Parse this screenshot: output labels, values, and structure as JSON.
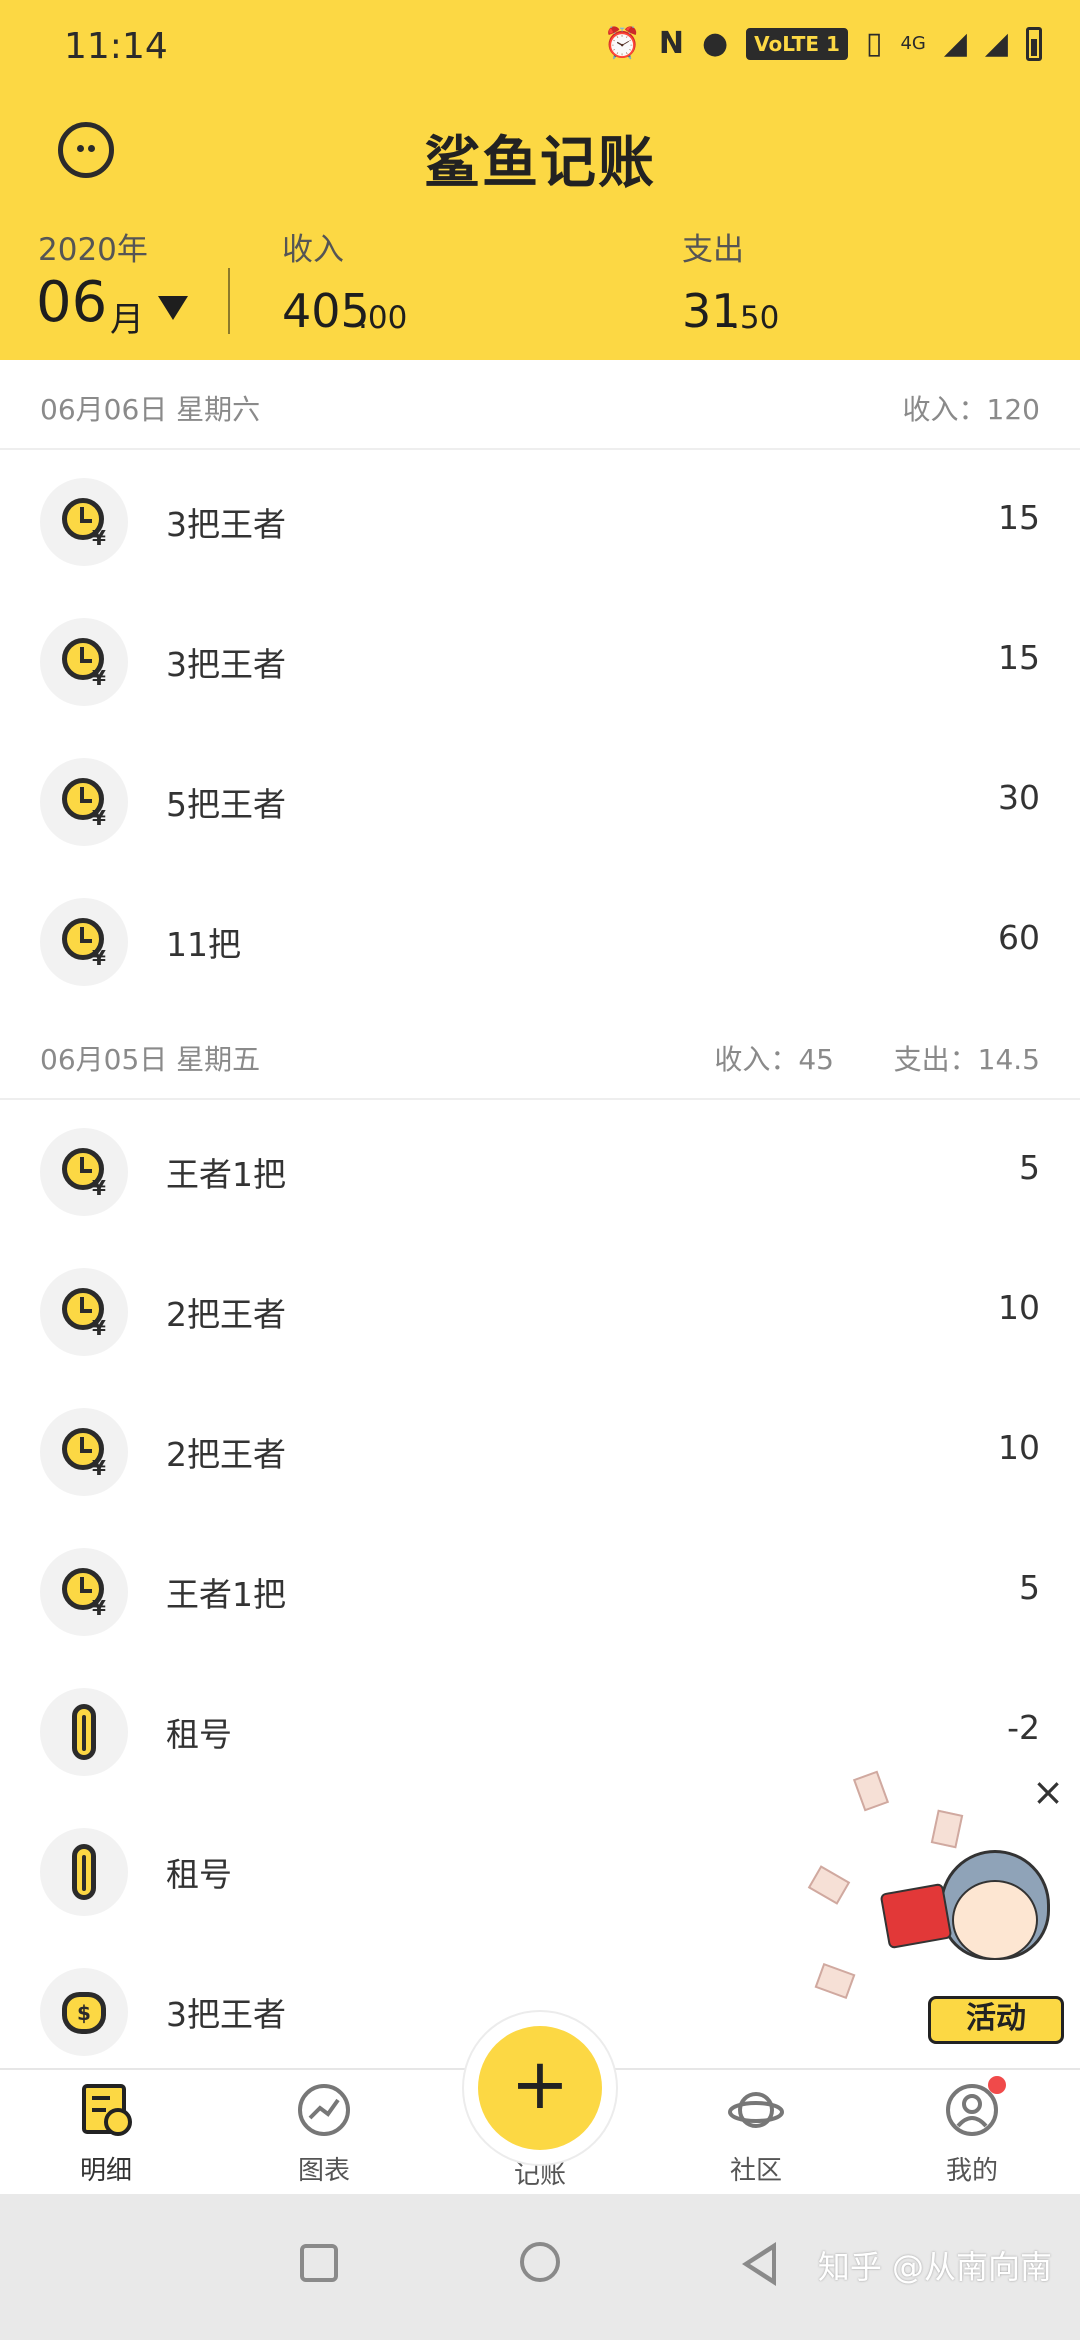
{
  "status_bar": {
    "time": "11:14",
    "network": "VoLTE 1",
    "signal": "4G"
  },
  "header": {
    "app_title": "鲨鱼记账",
    "year": "2020年",
    "month": "06",
    "month_suffix": "月",
    "income_label": "收入",
    "income_int": "405",
    "income_dec": ".00",
    "expense_label": "支出",
    "expense_int": "31",
    "expense_dec": ".50"
  },
  "days": [
    {
      "date": "06月06日 星期六",
      "income_summary": "收入：120",
      "items": [
        {
          "icon": "clock-yen-icon",
          "label": "3把王者",
          "amount": "15"
        },
        {
          "icon": "clock-yen-icon",
          "label": "3把王者",
          "amount": "15"
        },
        {
          "icon": "clock-yen-icon",
          "label": "5把王者",
          "amount": "30"
        },
        {
          "icon": "clock-yen-icon",
          "label": "11把",
          "amount": "60"
        }
      ]
    },
    {
      "date": "06月05日 星期五",
      "income_summary": "收入：45",
      "expense_summary": "支出：14.5",
      "items": [
        {
          "icon": "clock-yen-icon",
          "label": "王者1把",
          "amount": "5"
        },
        {
          "icon": "clock-yen-icon",
          "label": "2把王者",
          "amount": "10"
        },
        {
          "icon": "clock-yen-icon",
          "label": "2把王者",
          "amount": "10"
        },
        {
          "icon": "clock-yen-icon",
          "label": "王者1把",
          "amount": "5"
        },
        {
          "icon": "paperclip-icon",
          "label": "租号",
          "amount": "-2"
        },
        {
          "icon": "paperclip-icon",
          "label": "租号",
          "amount": "-"
        },
        {
          "icon": "money-bag-icon",
          "label": "3把王者",
          "amount": ""
        }
      ]
    }
  ],
  "activity": {
    "label": "活动",
    "close": "×"
  },
  "bottom_nav": [
    {
      "label": "明细",
      "icon": "detail-icon"
    },
    {
      "label": "图表",
      "icon": "chart-icon"
    },
    {
      "label": "记账",
      "icon": "plus-icon"
    },
    {
      "label": "社区",
      "icon": "planet-icon"
    },
    {
      "label": "我的",
      "icon": "profile-icon"
    }
  ],
  "fab": {
    "symbol": "+"
  },
  "watermark": "知乎 @从南向南",
  "colors": {
    "accent": "#FCD844",
    "text": "#333333",
    "muted": "#8a8a8a"
  }
}
